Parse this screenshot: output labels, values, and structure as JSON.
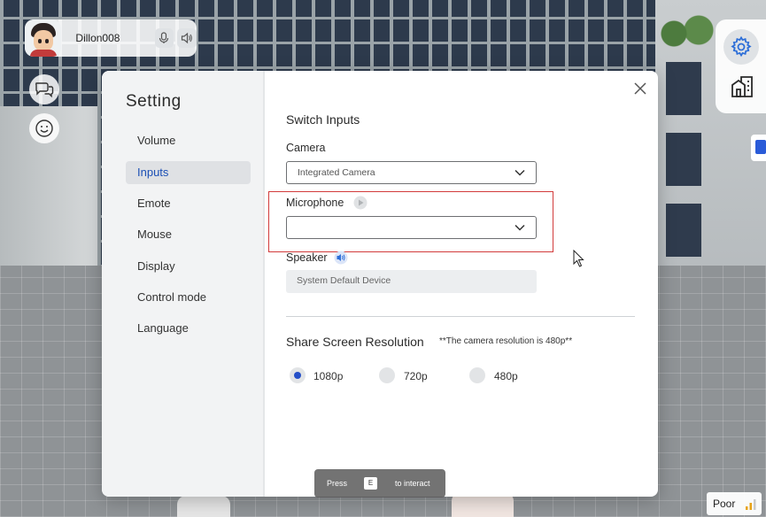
{
  "user": {
    "name": "Dillon008",
    "mic_icon": "microphone-icon",
    "speaker_icon": "speaker-icon"
  },
  "side_buttons": {
    "chat_icon": "chat-bubbles-icon",
    "emote_icon": "smiley-icon"
  },
  "right_toolbar": {
    "settings_icon": "gear-icon",
    "building_icon": "building-icon",
    "accent": "#2e6fd8"
  },
  "dialog": {
    "title": "Setting",
    "nav": [
      "Volume",
      "Inputs",
      "Emote",
      "Mouse",
      "Display",
      "Control mode",
      "Language"
    ],
    "active_nav": "Inputs",
    "close_icon": "close-icon",
    "switch_inputs": {
      "title": "Switch Inputs",
      "camera_label": "Camera",
      "camera_value": "Integrated Camera",
      "microphone_label": "Microphone",
      "microphone_value": "",
      "speaker_label": "Speaker",
      "speaker_value": "System Default Device"
    },
    "share_screen": {
      "title": "Share Screen Resolution",
      "note": "**The camera resolution is 480p**",
      "options": [
        "1080p",
        "720p",
        "480p"
      ],
      "selected": "1080p"
    },
    "highlight_color": "#d23b3b"
  },
  "hint": {
    "press": "Press",
    "key": "E",
    "interact": "to interact"
  },
  "network": {
    "quality": "Poor",
    "bar_color": "#e8a317"
  }
}
